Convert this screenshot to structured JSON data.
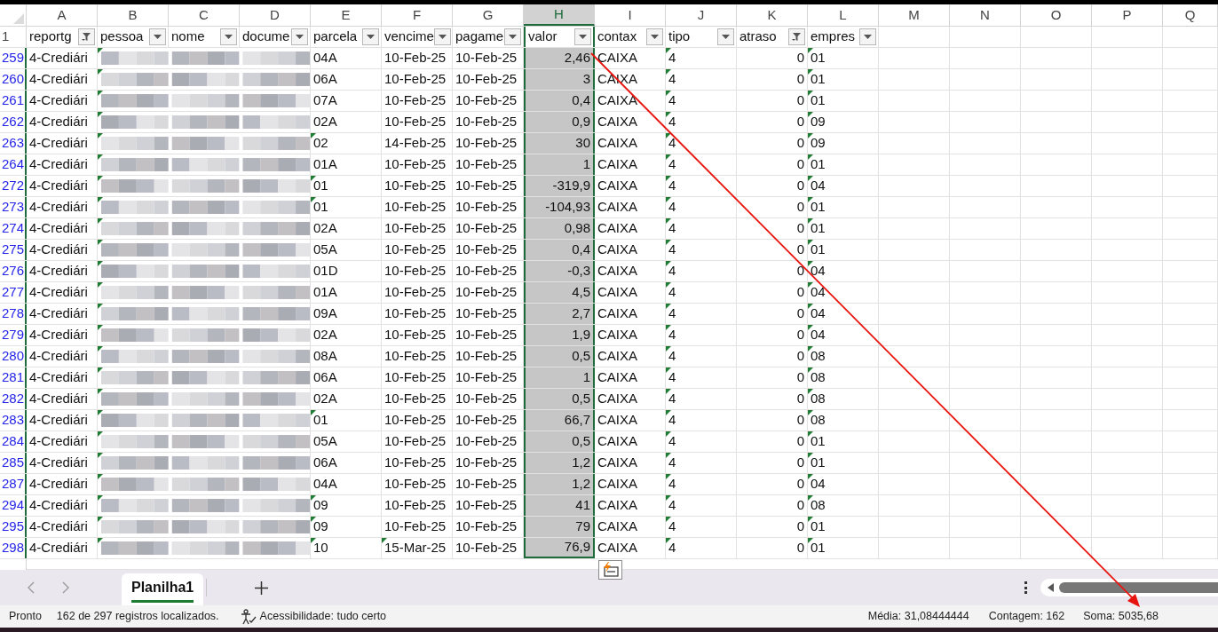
{
  "column_letters": [
    {
      "letter": "A",
      "selected": false
    },
    {
      "letter": "B",
      "selected": false
    },
    {
      "letter": "C",
      "selected": false
    },
    {
      "letter": "D",
      "selected": false
    },
    {
      "letter": "E",
      "selected": false
    },
    {
      "letter": "F",
      "selected": false
    },
    {
      "letter": "G",
      "selected": false
    },
    {
      "letter": "H",
      "selected": true
    },
    {
      "letter": "I",
      "selected": false
    },
    {
      "letter": "J",
      "selected": false
    },
    {
      "letter": "K",
      "selected": false
    },
    {
      "letter": "L",
      "selected": false
    },
    {
      "letter": "M",
      "selected": false
    },
    {
      "letter": "N",
      "selected": false
    },
    {
      "letter": "O",
      "selected": false
    },
    {
      "letter": "P",
      "selected": false
    },
    {
      "letter": "Q",
      "selected": false
    }
  ],
  "header_row": {
    "number": "1",
    "columns": [
      {
        "header": "reportg",
        "filtered": true
      },
      {
        "header": "pessoa",
        "filtered": false
      },
      {
        "header": "nome",
        "filtered": false
      },
      {
        "header": "docume",
        "filtered": false
      },
      {
        "header": "parcela",
        "filtered": false
      },
      {
        "header": "vencime",
        "filtered": false
      },
      {
        "header": "pagame",
        "filtered": false
      },
      {
        "header": "valor",
        "filtered": false
      },
      {
        "header": "contax",
        "filtered": false
      },
      {
        "header": "tipo",
        "filtered": false
      },
      {
        "header": "atraso",
        "filtered": true
      },
      {
        "header": "empres",
        "filtered": false
      }
    ]
  },
  "rows": [
    {
      "number": "259",
      "group": "4-Crediári",
      "pessoa_flag": true,
      "parcela": "04A",
      "parcela_flag": false,
      "vencimento": "10-Feb-25",
      "vencimento_flag": false,
      "pagamento": "10-Feb-25",
      "valor": "2,46",
      "contax": "CAIXA",
      "tipo": "4",
      "tipo_flag": true,
      "atraso": "0",
      "empresa": "01",
      "empresa_flag": true
    },
    {
      "number": "260",
      "group": "4-Crediári",
      "pessoa_flag": true,
      "parcela": "06A",
      "parcela_flag": false,
      "vencimento": "10-Feb-25",
      "vencimento_flag": false,
      "pagamento": "10-Feb-25",
      "valor": "3",
      "contax": "CAIXA",
      "tipo": "4",
      "tipo_flag": true,
      "atraso": "0",
      "empresa": "01",
      "empresa_flag": true
    },
    {
      "number": "261",
      "group": "4-Crediári",
      "pessoa_flag": true,
      "parcela": "07A",
      "parcela_flag": false,
      "vencimento": "10-Feb-25",
      "vencimento_flag": false,
      "pagamento": "10-Feb-25",
      "valor": "0,4",
      "contax": "CAIXA",
      "tipo": "4",
      "tipo_flag": true,
      "atraso": "0",
      "empresa": "01",
      "empresa_flag": true
    },
    {
      "number": "262",
      "group": "4-Crediári",
      "pessoa_flag": true,
      "parcela": "02A",
      "parcela_flag": false,
      "vencimento": "10-Feb-25",
      "vencimento_flag": false,
      "pagamento": "10-Feb-25",
      "valor": "0,9",
      "contax": "CAIXA",
      "tipo": "4",
      "tipo_flag": true,
      "atraso": "0",
      "empresa": "09",
      "empresa_flag": true
    },
    {
      "number": "263",
      "group": "4-Crediári",
      "pessoa_flag": true,
      "parcela": "02",
      "parcela_flag": true,
      "vencimento": "14-Feb-25",
      "vencimento_flag": false,
      "pagamento": "10-Feb-25",
      "valor": "30",
      "contax": "CAIXA",
      "tipo": "4",
      "tipo_flag": true,
      "atraso": "0",
      "empresa": "09",
      "empresa_flag": true
    },
    {
      "number": "264",
      "group": "4-Crediári",
      "pessoa_flag": true,
      "parcela": "01A",
      "parcela_flag": false,
      "vencimento": "10-Feb-25",
      "vencimento_flag": false,
      "pagamento": "10-Feb-25",
      "valor": "1",
      "contax": "CAIXA",
      "tipo": "4",
      "tipo_flag": true,
      "atraso": "0",
      "empresa": "01",
      "empresa_flag": true
    },
    {
      "number": "272",
      "group": "4-Crediári",
      "pessoa_flag": true,
      "parcela": "01",
      "parcela_flag": true,
      "vencimento": "10-Feb-25",
      "vencimento_flag": false,
      "pagamento": "10-Feb-25",
      "valor": "-319,9",
      "contax": "CAIXA",
      "tipo": "4",
      "tipo_flag": true,
      "atraso": "0",
      "empresa": "04",
      "empresa_flag": true
    },
    {
      "number": "273",
      "group": "4-Crediári",
      "pessoa_flag": true,
      "parcela": "01",
      "parcela_flag": true,
      "vencimento": "10-Feb-25",
      "vencimento_flag": false,
      "pagamento": "10-Feb-25",
      "valor": "-104,93",
      "contax": "CAIXA",
      "tipo": "4",
      "tipo_flag": true,
      "atraso": "0",
      "empresa": "01",
      "empresa_flag": true
    },
    {
      "number": "274",
      "group": "4-Crediári",
      "pessoa_flag": true,
      "parcela": "02A",
      "parcela_flag": false,
      "vencimento": "10-Feb-25",
      "vencimento_flag": false,
      "pagamento": "10-Feb-25",
      "valor": "0,98",
      "contax": "CAIXA",
      "tipo": "4",
      "tipo_flag": true,
      "atraso": "0",
      "empresa": "01",
      "empresa_flag": true
    },
    {
      "number": "275",
      "group": "4-Crediári",
      "pessoa_flag": true,
      "parcela": "05A",
      "parcela_flag": false,
      "vencimento": "10-Feb-25",
      "vencimento_flag": false,
      "pagamento": "10-Feb-25",
      "valor": "0,4",
      "contax": "CAIXA",
      "tipo": "4",
      "tipo_flag": true,
      "atraso": "0",
      "empresa": "01",
      "empresa_flag": true
    },
    {
      "number": "276",
      "group": "4-Crediári",
      "pessoa_flag": true,
      "parcela": "01D",
      "parcela_flag": false,
      "vencimento": "10-Feb-25",
      "vencimento_flag": false,
      "pagamento": "10-Feb-25",
      "valor": "-0,3",
      "contax": "CAIXA",
      "tipo": "4",
      "tipo_flag": true,
      "atraso": "0",
      "empresa": "04",
      "empresa_flag": true
    },
    {
      "number": "277",
      "group": "4-Crediári",
      "pessoa_flag": true,
      "parcela": "01A",
      "parcela_flag": false,
      "vencimento": "10-Feb-25",
      "vencimento_flag": false,
      "pagamento": "10-Feb-25",
      "valor": "4,5",
      "contax": "CAIXA",
      "tipo": "4",
      "tipo_flag": true,
      "atraso": "0",
      "empresa": "04",
      "empresa_flag": true
    },
    {
      "number": "278",
      "group": "4-Crediári",
      "pessoa_flag": true,
      "parcela": "09A",
      "parcela_flag": false,
      "vencimento": "10-Feb-25",
      "vencimento_flag": false,
      "pagamento": "10-Feb-25",
      "valor": "2,7",
      "contax": "CAIXA",
      "tipo": "4",
      "tipo_flag": true,
      "atraso": "0",
      "empresa": "04",
      "empresa_flag": true
    },
    {
      "number": "279",
      "group": "4-Crediári",
      "pessoa_flag": true,
      "parcela": "02A",
      "parcela_flag": false,
      "vencimento": "10-Feb-25",
      "vencimento_flag": false,
      "pagamento": "10-Feb-25",
      "valor": "1,9",
      "contax": "CAIXA",
      "tipo": "4",
      "tipo_flag": true,
      "atraso": "0",
      "empresa": "04",
      "empresa_flag": true
    },
    {
      "number": "280",
      "group": "4-Crediári",
      "pessoa_flag": true,
      "parcela": "08A",
      "parcela_flag": false,
      "vencimento": "10-Feb-25",
      "vencimento_flag": false,
      "pagamento": "10-Feb-25",
      "valor": "0,5",
      "contax": "CAIXA",
      "tipo": "4",
      "tipo_flag": true,
      "atraso": "0",
      "empresa": "08",
      "empresa_flag": true
    },
    {
      "number": "281",
      "group": "4-Crediári",
      "pessoa_flag": true,
      "parcela": "06A",
      "parcela_flag": false,
      "vencimento": "10-Feb-25",
      "vencimento_flag": false,
      "pagamento": "10-Feb-25",
      "valor": "1",
      "contax": "CAIXA",
      "tipo": "4",
      "tipo_flag": true,
      "atraso": "0",
      "empresa": "08",
      "empresa_flag": true
    },
    {
      "number": "282",
      "group": "4-Crediári",
      "pessoa_flag": true,
      "parcela": "02A",
      "parcela_flag": false,
      "vencimento": "10-Feb-25",
      "vencimento_flag": false,
      "pagamento": "10-Feb-25",
      "valor": "0,5",
      "contax": "CAIXA",
      "tipo": "4",
      "tipo_flag": true,
      "atraso": "0",
      "empresa": "08",
      "empresa_flag": true
    },
    {
      "number": "283",
      "group": "4-Crediári",
      "pessoa_flag": true,
      "parcela": "01",
      "parcela_flag": true,
      "vencimento": "10-Feb-25",
      "vencimento_flag": false,
      "pagamento": "10-Feb-25",
      "valor": "66,7",
      "contax": "CAIXA",
      "tipo": "4",
      "tipo_flag": true,
      "atraso": "0",
      "empresa": "08",
      "empresa_flag": true
    },
    {
      "number": "284",
      "group": "4-Crediári",
      "pessoa_flag": true,
      "parcela": "05A",
      "parcela_flag": false,
      "vencimento": "10-Feb-25",
      "vencimento_flag": false,
      "pagamento": "10-Feb-25",
      "valor": "0,5",
      "contax": "CAIXA",
      "tipo": "4",
      "tipo_flag": true,
      "atraso": "0",
      "empresa": "01",
      "empresa_flag": true
    },
    {
      "number": "285",
      "group": "4-Crediári",
      "pessoa_flag": true,
      "parcela": "06A",
      "parcela_flag": false,
      "vencimento": "10-Feb-25",
      "vencimento_flag": false,
      "pagamento": "10-Feb-25",
      "valor": "1,2",
      "contax": "CAIXA",
      "tipo": "4",
      "tipo_flag": true,
      "atraso": "0",
      "empresa": "01",
      "empresa_flag": true
    },
    {
      "number": "287",
      "group": "4-Crediári",
      "pessoa_flag": true,
      "parcela": "04A",
      "parcela_flag": false,
      "vencimento": "10-Feb-25",
      "vencimento_flag": false,
      "pagamento": "10-Feb-25",
      "valor": "1,2",
      "contax": "CAIXA",
      "tipo": "4",
      "tipo_flag": true,
      "atraso": "0",
      "empresa": "04",
      "empresa_flag": true
    },
    {
      "number": "294",
      "group": "4-Crediári",
      "pessoa_flag": true,
      "parcela": "09",
      "parcela_flag": true,
      "vencimento": "10-Feb-25",
      "vencimento_flag": false,
      "pagamento": "10-Feb-25",
      "valor": "41",
      "contax": "CAIXA",
      "tipo": "4",
      "tipo_flag": true,
      "atraso": "0",
      "empresa": "08",
      "empresa_flag": true
    },
    {
      "number": "295",
      "group": "4-Crediári",
      "pessoa_flag": true,
      "parcela": "09",
      "parcela_flag": true,
      "vencimento": "10-Feb-25",
      "vencimento_flag": false,
      "pagamento": "10-Feb-25",
      "valor": "79",
      "contax": "CAIXA",
      "tipo": "4",
      "tipo_flag": true,
      "atraso": "0",
      "empresa": "01",
      "empresa_flag": true
    },
    {
      "number": "298",
      "group": "4-Crediári",
      "pessoa_flag": true,
      "parcela": "10",
      "parcela_flag": true,
      "vencimento": "15-Mar-25",
      "vencimento_flag": true,
      "pagamento": "10-Feb-25",
      "valor": "76,9",
      "contax": "CAIXA",
      "tipo": "4",
      "tipo_flag": true,
      "atraso": "0",
      "empresa": "01",
      "empresa_flag": true
    }
  ],
  "sheet_tabs": [
    {
      "label": "Planilha1",
      "selected": true
    }
  ],
  "status_bar": {
    "mode": "Pronto",
    "records": "162 de 297 registros localizados.",
    "accessibility": "Acessibilidade: tudo certo",
    "average": "Média: 31,08444444",
    "count": "Contagem: 162",
    "sum": "Soma: 5035,68"
  }
}
